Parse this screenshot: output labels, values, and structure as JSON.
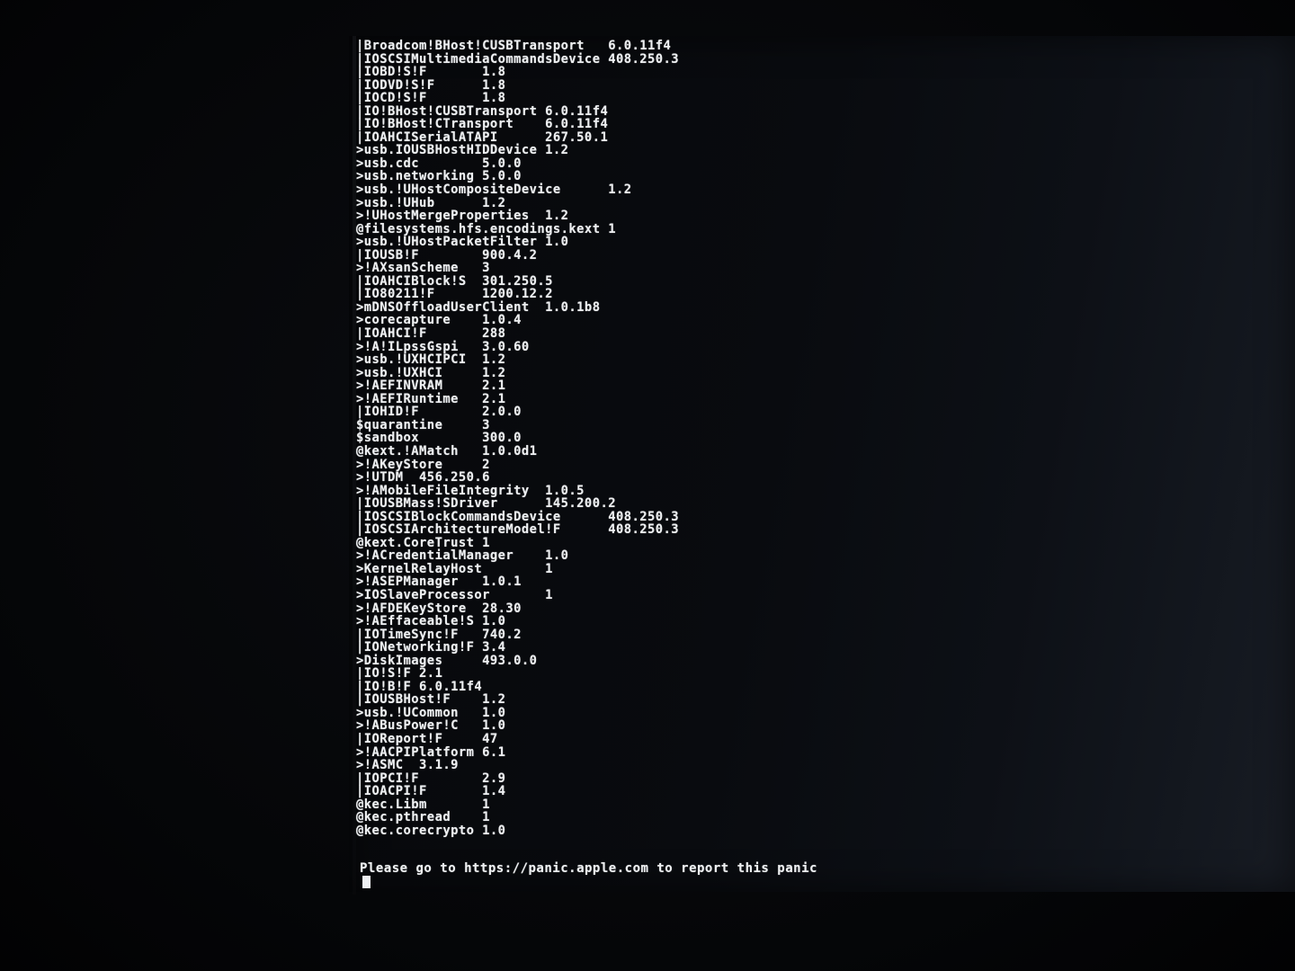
{
  "console": {
    "lines": [
      {
        "text": "|Broadcom!BHost!CUSBTransport   6.0.11f4"
      },
      {
        "text": "|IOSCSIMultimediaCommandsDevice 408.250.3"
      },
      {
        "text": "|IOBD!S!F       1.8"
      },
      {
        "text": "|IODVD!S!F      1.8"
      },
      {
        "text": "|IOCD!S!F       1.8"
      },
      {
        "text": "|IO!BHost!CUSBTransport 6.0.11f4"
      },
      {
        "text": "|IO!BHost!CTransport    6.0.11f4"
      },
      {
        "text": "|IOAHCISerialATAPI      267.50.1"
      },
      {
        "text": ">usb.IOUSBHostHIDDevice 1.2"
      },
      {
        "text": ">usb.cdc        5.0.0"
      },
      {
        "text": ">usb.networking 5.0.0"
      },
      {
        "text": ">usb.!UHostCompositeDevice      1.2"
      },
      {
        "text": ">usb.!UHub      1.2"
      },
      {
        "text": ">!UHostMergeProperties  1.2"
      },
      {
        "text": "@filesystems.hfs.encodings.kext 1"
      },
      {
        "text": ">usb.!UHostPacketFilter 1.0"
      },
      {
        "text": "|IOUSB!F        900.4.2"
      },
      {
        "text": ">!AXsanScheme   3"
      },
      {
        "text": "|IOAHCIBlock!S  301.250.5"
      },
      {
        "text": "|IO80211!F      1200.12.2"
      },
      {
        "text": ">mDNSOffloadUserClient  1.0.1b8"
      },
      {
        "text": ">corecapture    1.0.4"
      },
      {
        "text": "|IOAHCI!F       288"
      },
      {
        "text": ">!A!ILpssGspi   3.0.60"
      },
      {
        "text": ">usb.!UXHCIPCI  1.2"
      },
      {
        "text": ">usb.!UXHCI     1.2"
      },
      {
        "text": ">!AEFINVRAM     2.1"
      },
      {
        "text": ">!AEFIRuntime   2.1"
      },
      {
        "text": "|IOHID!F        2.0.0"
      },
      {
        "text": "$quarantine     3"
      },
      {
        "text": "$sandbox        300.0"
      },
      {
        "text": "@kext.!AMatch   1.0.0d1"
      },
      {
        "text": ">!AKeyStore     2"
      },
      {
        "text": ">!UTDM  456.250.6"
      },
      {
        "text": ">!AMobileFileIntegrity  1.0.5"
      },
      {
        "text": "|IOUSBMass!SDriver      145.200.2"
      },
      {
        "text": "|IOSCSIBlockCommandsDevice      408.250.3"
      },
      {
        "text": "|IOSCSIArchitectureModel!F      408.250.3"
      },
      {
        "text": "@kext.CoreTrust 1"
      },
      {
        "text": ">!ACredentialManager    1.0"
      },
      {
        "text": ">KernelRelayHost        1"
      },
      {
        "text": ">!ASEPManager   1.0.1"
      },
      {
        "text": ">IOSlaveProcessor       1"
      },
      {
        "text": ">!AFDEKeyStore  28.30"
      },
      {
        "text": ">!AEffaceable!S 1.0"
      },
      {
        "text": "|IOTimeSync!F   740.2"
      },
      {
        "text": "|IONetworking!F 3.4"
      },
      {
        "text": ">DiskImages     493.0.0"
      },
      {
        "text": "|IO!S!F 2.1"
      },
      {
        "text": "|IO!B!F 6.0.11f4"
      },
      {
        "text": "|IOUSBHost!F    1.2"
      },
      {
        "text": ">usb.!UCommon   1.0"
      },
      {
        "text": ">!ABusPower!C   1.0"
      },
      {
        "text": "|IOReport!F     47"
      },
      {
        "text": ">!AACPIPlatform 6.1"
      },
      {
        "text": ">!ASMC  3.1.9"
      },
      {
        "text": "|IOPCI!F        2.9"
      },
      {
        "text": "|IOACPI!F       1.4"
      },
      {
        "text": "@kec.Libm       1"
      },
      {
        "text": "@kec.pthread    1"
      },
      {
        "text": "@kec.corecrypto 1.0"
      }
    ],
    "panic_message": "Please go to https://panic.apple.com to report this panic"
  },
  "colors": {
    "text": "#eef0f2",
    "background": "#07080b"
  }
}
